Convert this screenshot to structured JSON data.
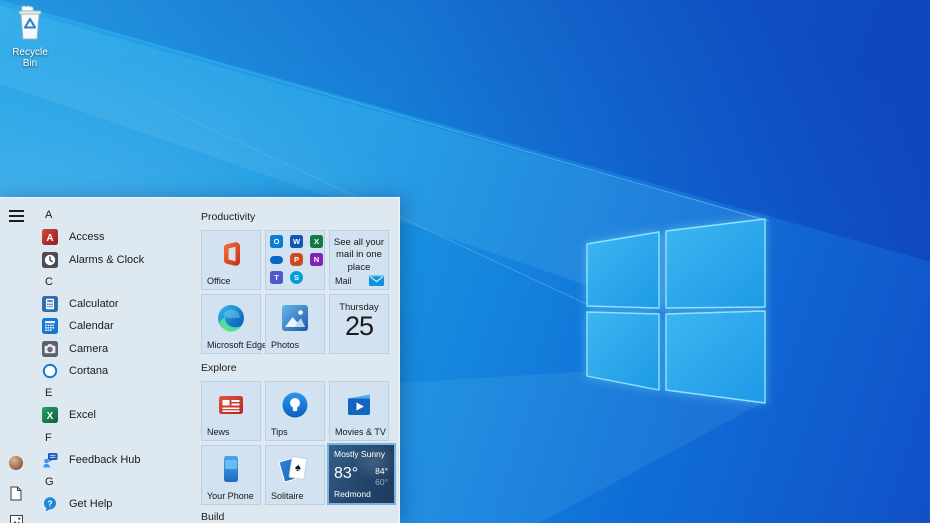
{
  "desktop": {
    "recycle_bin": {
      "label": "Recycle Bin",
      "icon": "recycle-bin-icon"
    }
  },
  "colors": {
    "wallpaper_azure": "#1a97e3",
    "wallpaper_royal": "#1150c8",
    "menu_bg": "#dde8f0",
    "tile_bg": "#d3e2f0",
    "weather_tile_bg": "#24466b",
    "weather_tile_border": "#7bb2e0",
    "text_dark": "#1b1b1b"
  },
  "start_menu": {
    "rail": {
      "items": [
        {
          "icon": "hamburger-icon"
        },
        {
          "icon": "user-avatar-icon"
        },
        {
          "icon": "documents-icon"
        },
        {
          "icon": "pictures-icon"
        }
      ]
    },
    "app_list": [
      {
        "kind": "header",
        "label": "A"
      },
      {
        "kind": "app",
        "label": "Access",
        "icon": "access-icon"
      },
      {
        "kind": "app",
        "label": "Alarms & Clock",
        "icon": "alarms-clock-icon"
      },
      {
        "kind": "header",
        "label": "C"
      },
      {
        "kind": "app",
        "label": "Calculator",
        "icon": "calculator-icon"
      },
      {
        "kind": "app",
        "label": "Calendar",
        "icon": "calendar-icon"
      },
      {
        "kind": "app",
        "label": "Camera",
        "icon": "camera-icon"
      },
      {
        "kind": "app",
        "label": "Cortana",
        "icon": "cortana-icon"
      },
      {
        "kind": "header",
        "label": "E"
      },
      {
        "kind": "app",
        "label": "Excel",
        "icon": "excel-icon"
      },
      {
        "kind": "header",
        "label": "F"
      },
      {
        "kind": "app",
        "label": "Feedback Hub",
        "icon": "feedback-hub-icon"
      },
      {
        "kind": "header",
        "label": "G"
      },
      {
        "kind": "app",
        "label": "Get Help",
        "icon": "get-help-icon"
      }
    ],
    "icon_glyphs": {
      "access": "A",
      "excel": "X",
      "get_help": "?",
      "solitaire_suit": "♠"
    },
    "tile_groups": [
      {
        "title": "Productivity"
      },
      {
        "title": "Explore"
      },
      {
        "title": "Build"
      }
    ],
    "tiles": {
      "office": {
        "label": "Office"
      },
      "office_folder": {
        "icons": [
          "outlook-icon",
          "word-icon",
          "excel-icon",
          "onedrive-icon",
          "powerpoint-icon",
          "onenote-icon",
          "teams-icon",
          "skype-icon"
        ],
        "letters": [
          "O",
          "W",
          "X",
          "",
          "P",
          "N",
          "T",
          "S"
        ]
      },
      "mail": {
        "message": "See all your mail in one place",
        "label": "Mail",
        "icon": "mail-envelope-icon"
      },
      "edge": {
        "label": "Microsoft Edge"
      },
      "photos": {
        "label": "Photos"
      },
      "calendar": {
        "day": "Thursday",
        "date": "25"
      },
      "news": {
        "label": "News"
      },
      "tips": {
        "label": "Tips"
      },
      "movies": {
        "label": "Movies & TV"
      },
      "your_phone": {
        "label": "Your Phone"
      },
      "solitaire": {
        "label": "Solitaire"
      },
      "weather": {
        "condition": "Mostly Sunny",
        "current_temp": "83°",
        "high": "84°",
        "low": "60°",
        "location": "Redmond"
      }
    }
  }
}
